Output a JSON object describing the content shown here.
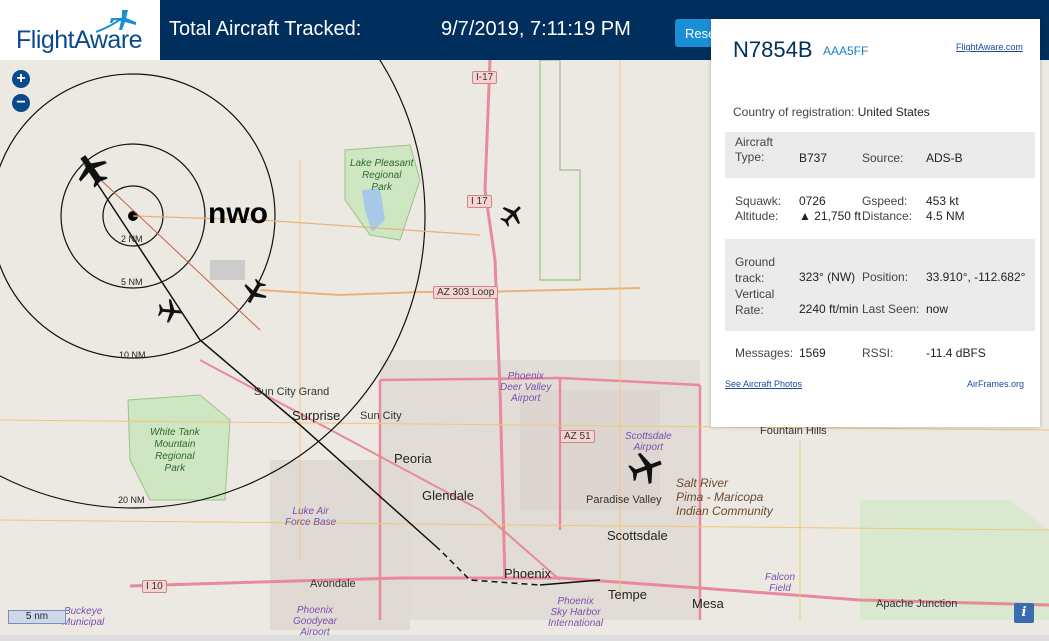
{
  "header": {
    "logo_text": "FlightAware",
    "tracked_label": "Total Aircraft Tracked:",
    "datetime": "9/7/2019, 7:11:19 PM",
    "reset_label": "Rese"
  },
  "map": {
    "annotation": "nwo",
    "zoom_in": "+",
    "zoom_out": "−",
    "scale_label": "5 nm",
    "info_label": "i",
    "ring_labels": [
      "2 NM",
      "5 NM",
      "10 NM",
      "20 NM"
    ],
    "places": {
      "lake_pleasant": "Lake Pleasant\nRegional\nPark",
      "white_tank": "White Tank\nMountain\nRegional\nPark",
      "sun_city_grand": "Sun City Grand",
      "surprise": "Surprise",
      "sun_city": "Sun City",
      "peoria": "Peoria",
      "glendale": "Glendale",
      "luke": "Luke Air\nForce Base",
      "phoenix_dv": "Phoenix\nDeer Valley\nAirport",
      "scottsdale_ap": "Scottsdale\nAirport",
      "fountain_hills": "Fountain Hills",
      "salt_river": "Salt River\nPima - Maricopa\nIndian Community",
      "paradise_valley": "Paradise Valley",
      "scottsdale": "Scottsdale",
      "phoenix": "Phoenix",
      "tempe": "Tempe",
      "mesa": "Mesa",
      "sky_harbor": "Phoenix\nSky Harbor\nInternational",
      "falcon": "Falcon\nField",
      "apache": "Apache Junction",
      "avondale": "Avondale",
      "buckeye": "Buckeye\nMunicipal",
      "goodyear": "Phoenix\nGoodyear\nAirport"
    },
    "shields": {
      "i17_top": "I-17",
      "i17_mid": "I 17",
      "az303": "AZ 303 Loop",
      "az51": "AZ 51",
      "i10": "I 10"
    }
  },
  "panel": {
    "registration": "N7854B",
    "hex": "AAA5FF",
    "fa_link": "FlightAware.com",
    "country_label": "Country of registration:",
    "country_value": "United States",
    "aircraft_type_label": "Aircraft\nType:",
    "aircraft_type": "B737",
    "source_label": "Source:",
    "source": "ADS-B",
    "squawk_label": "Squawk:",
    "squawk": "0726",
    "gspeed_label": "Gspeed:",
    "gspeed": "453 kt",
    "altitude_label": "Altitude:",
    "altitude": "▲ 21,750 ft",
    "distance_label": "Distance:",
    "distance": "4.5 NM",
    "track_label": "Ground\ntrack:",
    "track": "323° (NW)",
    "position_label": "Position:",
    "position": "33.910°, -112.682°",
    "vrate_label": "Vertical\nRate:",
    "vrate": "2240 ft/min",
    "lastseen_label": "Last Seen:",
    "lastseen": "now",
    "messages_label": "Messages:",
    "messages": "1569",
    "rssi_label": "RSSI:",
    "rssi": "-11.4 dBFS",
    "photos_link": "See Aircraft Photos",
    "airframes_link": "AirFrames.org"
  }
}
